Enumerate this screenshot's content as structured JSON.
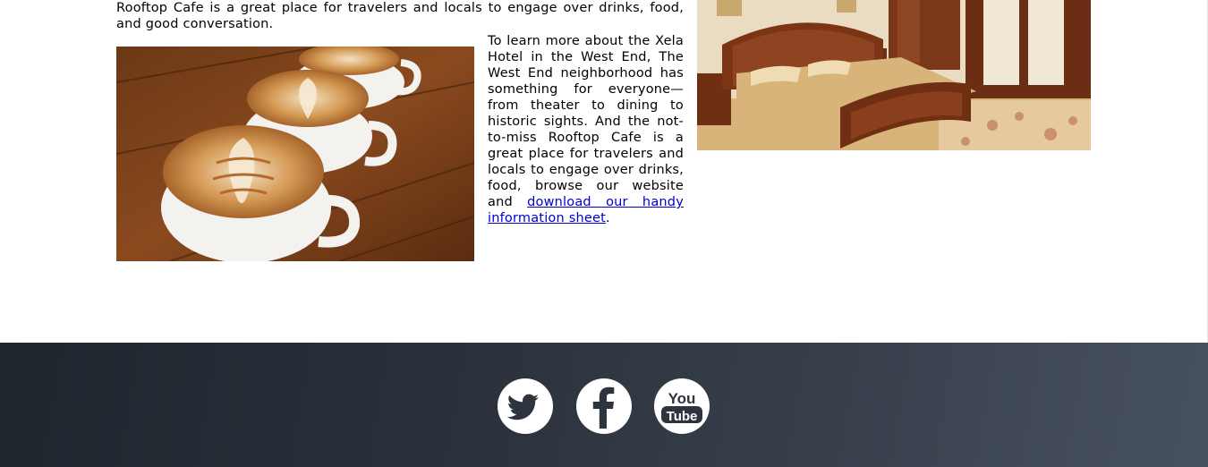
{
  "content": {
    "intro": "Rooftop Cafe is a great place for travelers and locals to engage over drinks, food, and good conversation.",
    "side_text_before_link": "To learn more about the Xela Hotel in the West End, The West End neighborhood has something for everyone—from theater to dining to historic sights. And the not-to-miss Rooftop Cafe is a great place for travelers and locals to engage over drinks, food, browse our website and ",
    "side_link": "download our handy information sheet",
    "side_text_after_link": "."
  },
  "images": {
    "coffee": "latte-art-cups-on-wooden-table",
    "room": "hotel-bedroom-with-wooden-bed"
  },
  "footer": {
    "social": [
      {
        "name": "twitter",
        "icon": "twitter-bird-icon"
      },
      {
        "name": "facebook",
        "icon": "facebook-f-icon"
      },
      {
        "name": "youtube",
        "icon": "youtube-logo-icon",
        "line1": "You",
        "line2": "Tube"
      }
    ]
  },
  "colors": {
    "link": "#0000cc",
    "footer_dark": "#1f252d",
    "footer_light": "#48525e",
    "icon_fill": "#2d343d"
  }
}
